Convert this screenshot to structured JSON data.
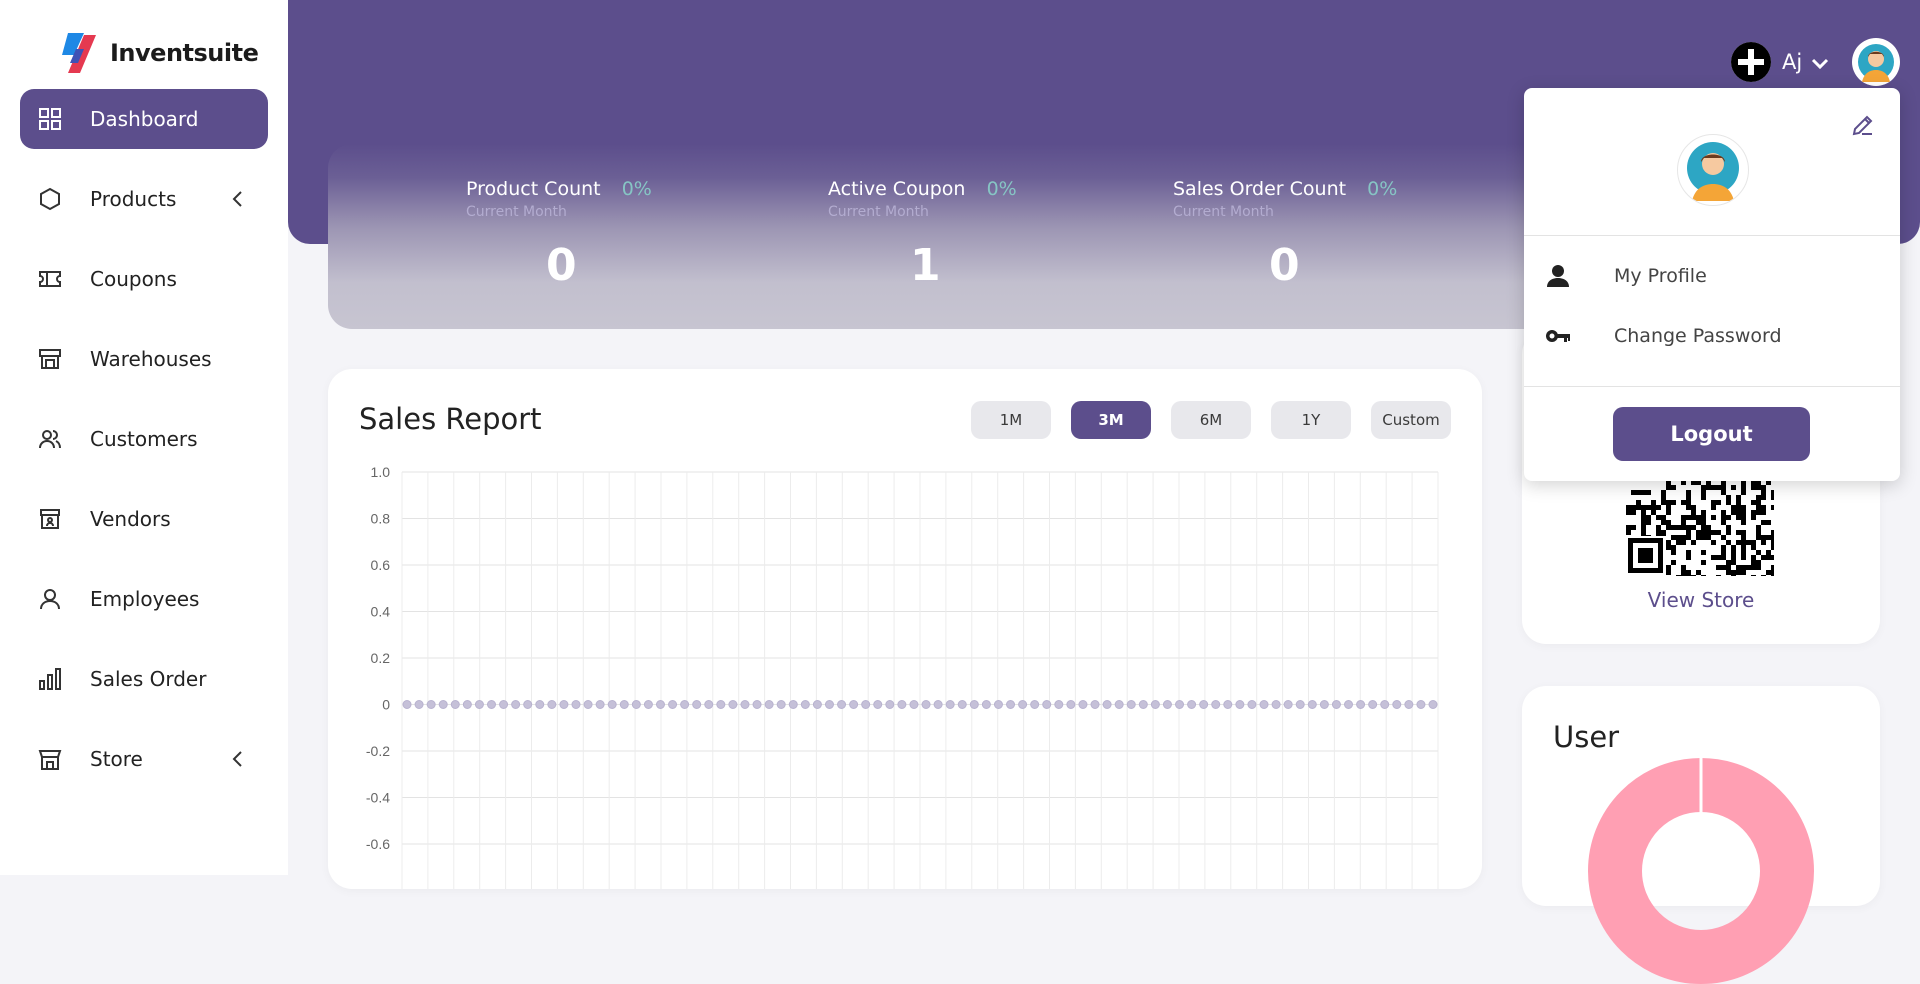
{
  "app": {
    "name": "Inventsuite"
  },
  "sidebar": {
    "items": [
      {
        "label": "Dashboard",
        "icon": "grid-icon",
        "active": true
      },
      {
        "label": "Products",
        "icon": "hexagon-icon",
        "has_submenu": true
      },
      {
        "label": "Coupons",
        "icon": "ticket-icon"
      },
      {
        "label": "Warehouses",
        "icon": "warehouse-icon"
      },
      {
        "label": "Customers",
        "icon": "users-icon"
      },
      {
        "label": "Vendors",
        "icon": "vendor-icon"
      },
      {
        "label": "Employees",
        "icon": "person-icon"
      },
      {
        "label": "Sales Order",
        "icon": "bar-chart-icon"
      },
      {
        "label": "Store",
        "icon": "store-icon",
        "has_submenu": true
      }
    ]
  },
  "header": {
    "user_name": "Aj",
    "accent": "#5c4e8c"
  },
  "stats": [
    {
      "title": "Product Count",
      "pct": "0%",
      "sub": "Current Month",
      "value": "0"
    },
    {
      "title": "Active Coupon",
      "pct": "0%",
      "sub": "Current Month",
      "value": "1"
    },
    {
      "title": "Sales Order Count",
      "pct": "0%",
      "sub": "Current Month",
      "value": "0"
    }
  ],
  "sales_report": {
    "title": "Sales Report",
    "ranges": [
      "1M",
      "3M",
      "6M",
      "1Y",
      "Custom"
    ],
    "active_range": "3M"
  },
  "chart_data": {
    "type": "line",
    "title": "",
    "xlabel": "",
    "ylabel": "",
    "ylim": [
      -1.0,
      1.0
    ],
    "y_ticks": [
      "1.0",
      "0.8",
      "0.6",
      "0.4",
      "0.2",
      "0",
      "-0.2",
      "-0.4",
      "-0.6"
    ],
    "point_count": 86,
    "series": [
      {
        "values": [
          0,
          0,
          0,
          0,
          0,
          0,
          0,
          0,
          0,
          0,
          0,
          0,
          0,
          0,
          0,
          0,
          0,
          0,
          0,
          0,
          0,
          0,
          0,
          0,
          0,
          0,
          0,
          0,
          0,
          0,
          0,
          0,
          0,
          0,
          0,
          0,
          0,
          0,
          0,
          0,
          0,
          0,
          0,
          0,
          0,
          0,
          0,
          0,
          0,
          0,
          0,
          0,
          0,
          0,
          0,
          0,
          0,
          0,
          0,
          0,
          0,
          0,
          0,
          0,
          0,
          0,
          0,
          0,
          0,
          0,
          0,
          0,
          0,
          0,
          0,
          0,
          0,
          0,
          0,
          0,
          0,
          0,
          0,
          0,
          0,
          0
        ]
      }
    ],
    "grid": true,
    "point_color": "#c5c0d8"
  },
  "store": {
    "link": "View Store"
  },
  "user_card": {
    "title": "User",
    "donut_color": "#ff9fb3"
  },
  "dropdown": {
    "items": [
      {
        "label": "My Profile",
        "icon": "person-icon"
      },
      {
        "label": "Change Password",
        "icon": "key-icon"
      }
    ],
    "logout": "Logout"
  }
}
